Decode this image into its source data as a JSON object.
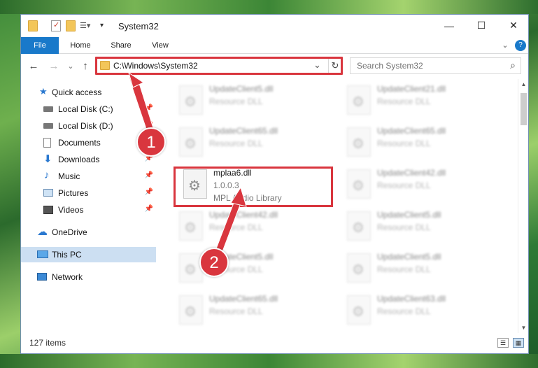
{
  "window": {
    "title": "System32",
    "min": "—",
    "max": "☐",
    "close": "✕"
  },
  "ribbon": {
    "tabs": [
      {
        "label": "File"
      },
      {
        "label": "Home"
      },
      {
        "label": "Share"
      },
      {
        "label": "View"
      }
    ],
    "expand": "⌄",
    "help": "?"
  },
  "address": {
    "path": "C:\\Windows\\System32",
    "dropdown": "⌄",
    "refresh": "↻",
    "back": "←",
    "forward": "→",
    "recent": "⌄",
    "up": "↑"
  },
  "search": {
    "placeholder": "Search System32",
    "icon": "⌕"
  },
  "sidebar": {
    "items": [
      {
        "label": "Quick access",
        "icon": "star-icon"
      },
      {
        "label": "Local Disk (C:)",
        "icon": "drive-icon",
        "pinned": true
      },
      {
        "label": "Local Disk (D:)",
        "icon": "drive-icon",
        "pinned": true
      },
      {
        "label": "Documents",
        "icon": "documents-icon",
        "pinned": true
      },
      {
        "label": "Downloads",
        "icon": "download-icon",
        "pinned": true
      },
      {
        "label": "Music",
        "icon": "music-icon",
        "pinned": true
      },
      {
        "label": "Pictures",
        "icon": "pictures-icon",
        "pinned": true
      },
      {
        "label": "Videos",
        "icon": "videos-icon",
        "pinned": true
      },
      {
        "label": "OneDrive",
        "icon": "cloud-icon"
      },
      {
        "label": "This PC",
        "icon": "computer-icon",
        "selected": true
      },
      {
        "label": "Network",
        "icon": "network-icon"
      }
    ]
  },
  "files": {
    "highlighted": {
      "name": "mplaa6.dll",
      "version": "1.0.0.3",
      "description": "MPL Audio Library"
    },
    "blurred": [
      {
        "name": "UpdateClient5.dll",
        "desc": "Resource DLL"
      },
      {
        "name": "UpdateClient21.dll",
        "desc": "Resource DLL"
      },
      {
        "name": "UpdateClient65.dll",
        "desc": "Resource DLL"
      },
      {
        "name": "UpdateClient65.dll",
        "desc": "Resource DLL"
      },
      {
        "name": "UpdateClient42.dll",
        "desc": "Resource DLL"
      },
      {
        "name": "UpdateClient42.dll",
        "desc": "Resource DLL"
      },
      {
        "name": "UpdateClient5.dll",
        "desc": "Resource DLL"
      },
      {
        "name": "UpdateClient5.dll",
        "desc": "Resource DLL"
      },
      {
        "name": "UpdateClient5.dll",
        "desc": "Resource DLL"
      },
      {
        "name": "UpdateClient65.dll",
        "desc": "Resource DLL"
      },
      {
        "name": "UpdateClient63.dll",
        "desc": "Resource DLL"
      }
    ]
  },
  "status": {
    "count": "127 items"
  },
  "annotations": {
    "step1": "1",
    "step2": "2",
    "color": "#d9363e"
  }
}
